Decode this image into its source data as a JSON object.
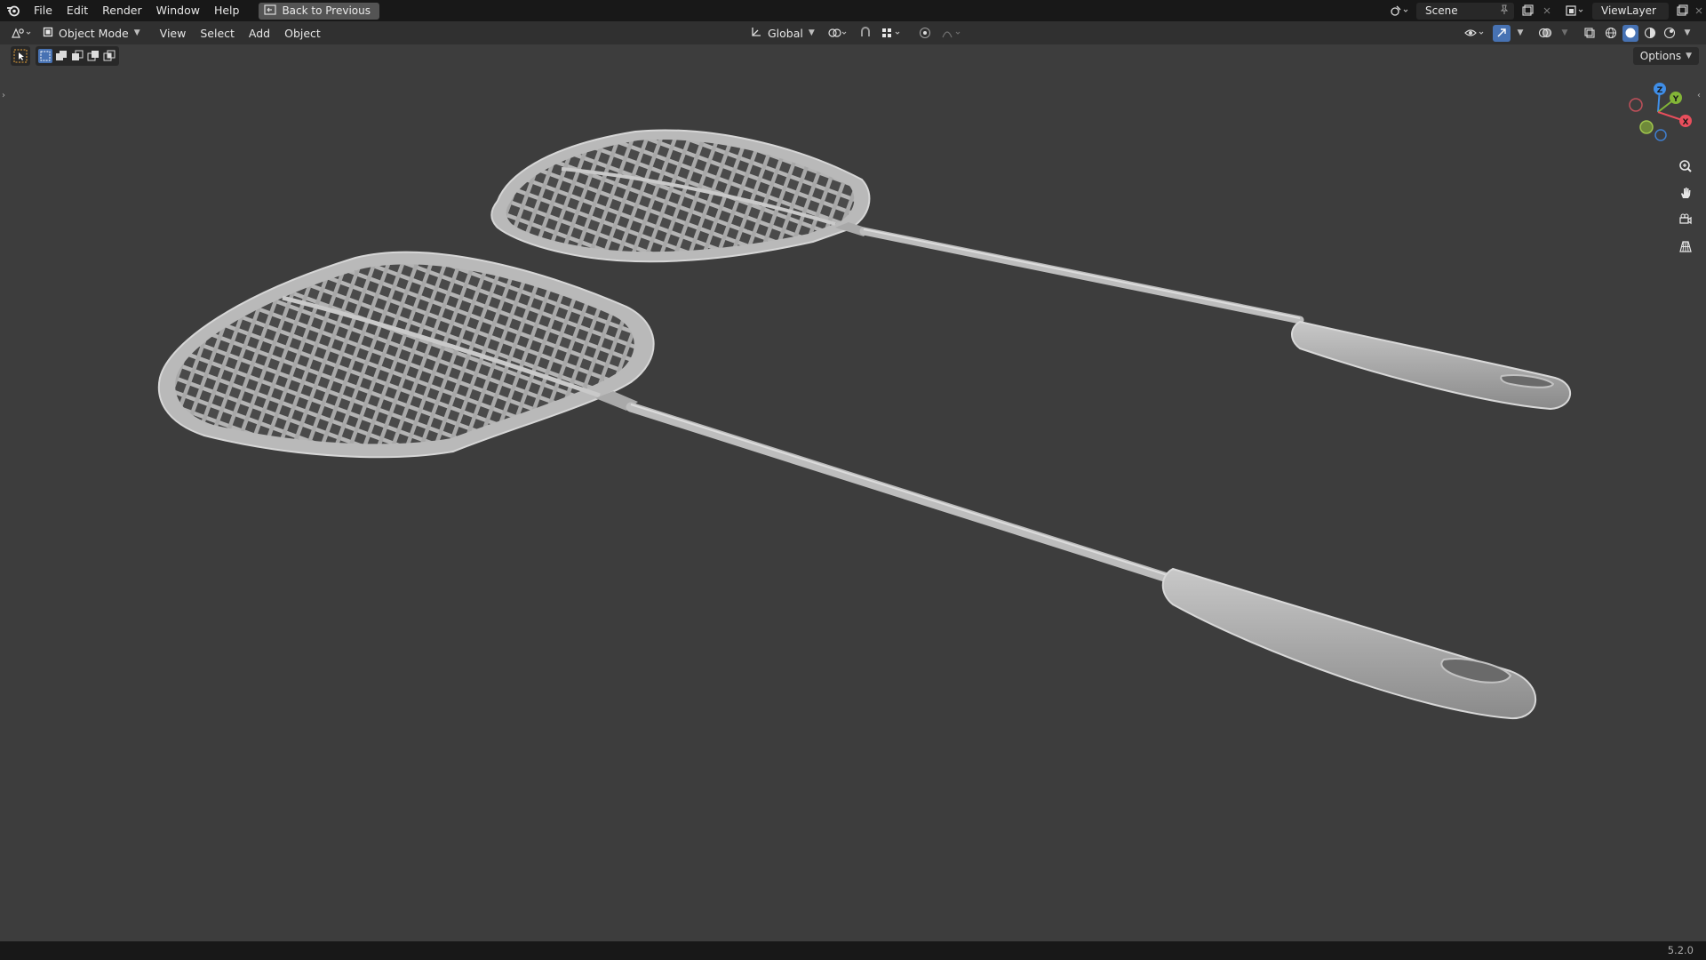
{
  "topbar": {
    "menu": [
      "File",
      "Edit",
      "Render",
      "Window",
      "Help"
    ],
    "back_label": "Back to Previous",
    "scene_name": "Scene",
    "view_layer": "ViewLayer"
  },
  "header": {
    "mode": "Object Mode",
    "menus": [
      "View",
      "Select",
      "Add",
      "Object"
    ],
    "transform_orientation": "Global",
    "options_label": "Options"
  },
  "status": {
    "version": "5.2.0"
  },
  "gizmo": {
    "x_label": "X",
    "y_label": "Y",
    "z_label": "Z"
  },
  "icons": [
    "blender-logo-icon",
    "fullscreen-back-icon",
    "scene-icon",
    "pin-icon",
    "new-scene-icon",
    "close-icon",
    "view-layer-icon",
    "editor-type-icon",
    "object-mode-icon",
    "orientation-icon",
    "pivot-icon",
    "snap-icon",
    "proportional-edit-icon",
    "visibility-icon",
    "gizmo-icon",
    "overlay-icon",
    "xray-icon",
    "shading-wireframe-icon",
    "shading-solid-icon",
    "shading-material-icon",
    "shading-rendered-icon",
    "zoom-icon",
    "pan-hand-icon",
    "camera-view-icon",
    "ortho-grid-icon"
  ],
  "colors": {
    "accent": "#4772b3",
    "axis_x": "#e94e5c",
    "axis_y": "#83b537",
    "axis_z": "#3f8ee8"
  }
}
